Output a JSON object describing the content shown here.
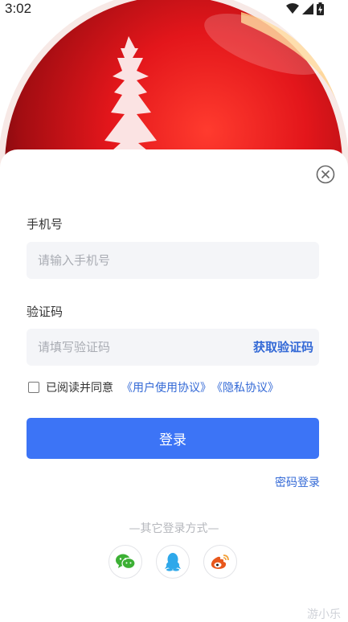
{
  "status_bar": {
    "time": "3:02",
    "icons": [
      "wifi-icon",
      "cellular-signal-icon",
      "battery-charging-icon"
    ]
  },
  "hero": {
    "image": "red-crystal-ball-with-pagoda"
  },
  "form": {
    "phone": {
      "label": "手机号",
      "placeholder": "请输入手机号",
      "value": ""
    },
    "code": {
      "label": "验证码",
      "placeholder": "请填写验证码",
      "value": "",
      "get_code_label": "获取验证码"
    },
    "agreement": {
      "checked": false,
      "prefix": "已阅读并同意",
      "user_agreement": "《用户使用协议》",
      "privacy_policy": "《隐私协议》"
    },
    "login_button": "登录",
    "password_login": "密码登录"
  },
  "other_login": {
    "title": "—其它登录方式—",
    "methods": [
      "wechat-icon",
      "qq-icon",
      "weibo-icon"
    ]
  },
  "watermark": "游小乐",
  "colors": {
    "accent": "#3c74f6",
    "link": "#3369d6",
    "field_bg": "#f4f5f8",
    "wechat": "#3cb034",
    "qq": "#2ea8ea",
    "weibo": "#e8581d"
  }
}
